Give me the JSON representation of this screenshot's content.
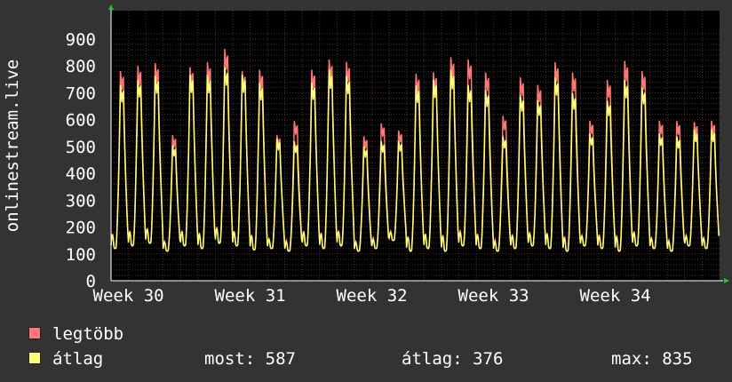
{
  "chart_data": {
    "type": "line",
    "title": "",
    "ylabel": "onlinestream.live",
    "ylim": [
      0,
      900
    ],
    "yticks": [
      0,
      100,
      200,
      300,
      400,
      500,
      600,
      700,
      800,
      900
    ],
    "xlabels": [
      "Week 30",
      "Week 31",
      "Week 32",
      "Week 33",
      "Week 34"
    ],
    "x_range_days": [
      0,
      35
    ],
    "daily_peaks_max": [
      815,
      835,
      845,
      565,
      830,
      850,
      900,
      815,
      820,
      565,
      620,
      820,
      860,
      850,
      560,
      610,
      580,
      805,
      810,
      870,
      860,
      810,
      640,
      790,
      760,
      850,
      810,
      620,
      780,
      855,
      815,
      620,
      620,
      615,
      620
    ],
    "daily_peaks_avg": [
      760,
      780,
      795,
      525,
      800,
      800,
      830,
      800,
      770,
      550,
      540,
      770,
      820,
      795,
      520,
      540,
      540,
      760,
      780,
      820,
      760,
      740,
      560,
      720,
      700,
      790,
      730,
      570,
      700,
      780,
      750,
      570,
      560,
      585,
      587
    ],
    "daily_troughs": [
      120,
      130,
      140,
      110,
      130,
      120,
      140,
      130,
      115,
      120,
      110,
      130,
      120,
      130,
      110,
      120,
      150,
      110,
      120,
      110,
      130,
      120,
      110,
      120,
      130,
      120,
      110,
      130,
      120,
      110,
      130,
      120,
      110,
      130,
      120
    ],
    "series": [
      {
        "name": "legtöbb",
        "color": "#ff7777"
      },
      {
        "name": "átlag",
        "color": "#ffff77"
      }
    ],
    "grid": true,
    "legend_position": "bottom"
  },
  "legend": {
    "max_label": "legtöbb",
    "avg_label": "átlag",
    "stats": {
      "most": "most: 587",
      "atlag": "átlag: 376",
      "max": "max: 835"
    }
  },
  "colors": {
    "background": "#333333",
    "plot_background": "#000000",
    "grid": "#3a3a3a",
    "week_grid": "#5a2020",
    "axis_arrow": "#22cc22",
    "max_series": "#ff7777",
    "avg_series": "#ffff77"
  }
}
